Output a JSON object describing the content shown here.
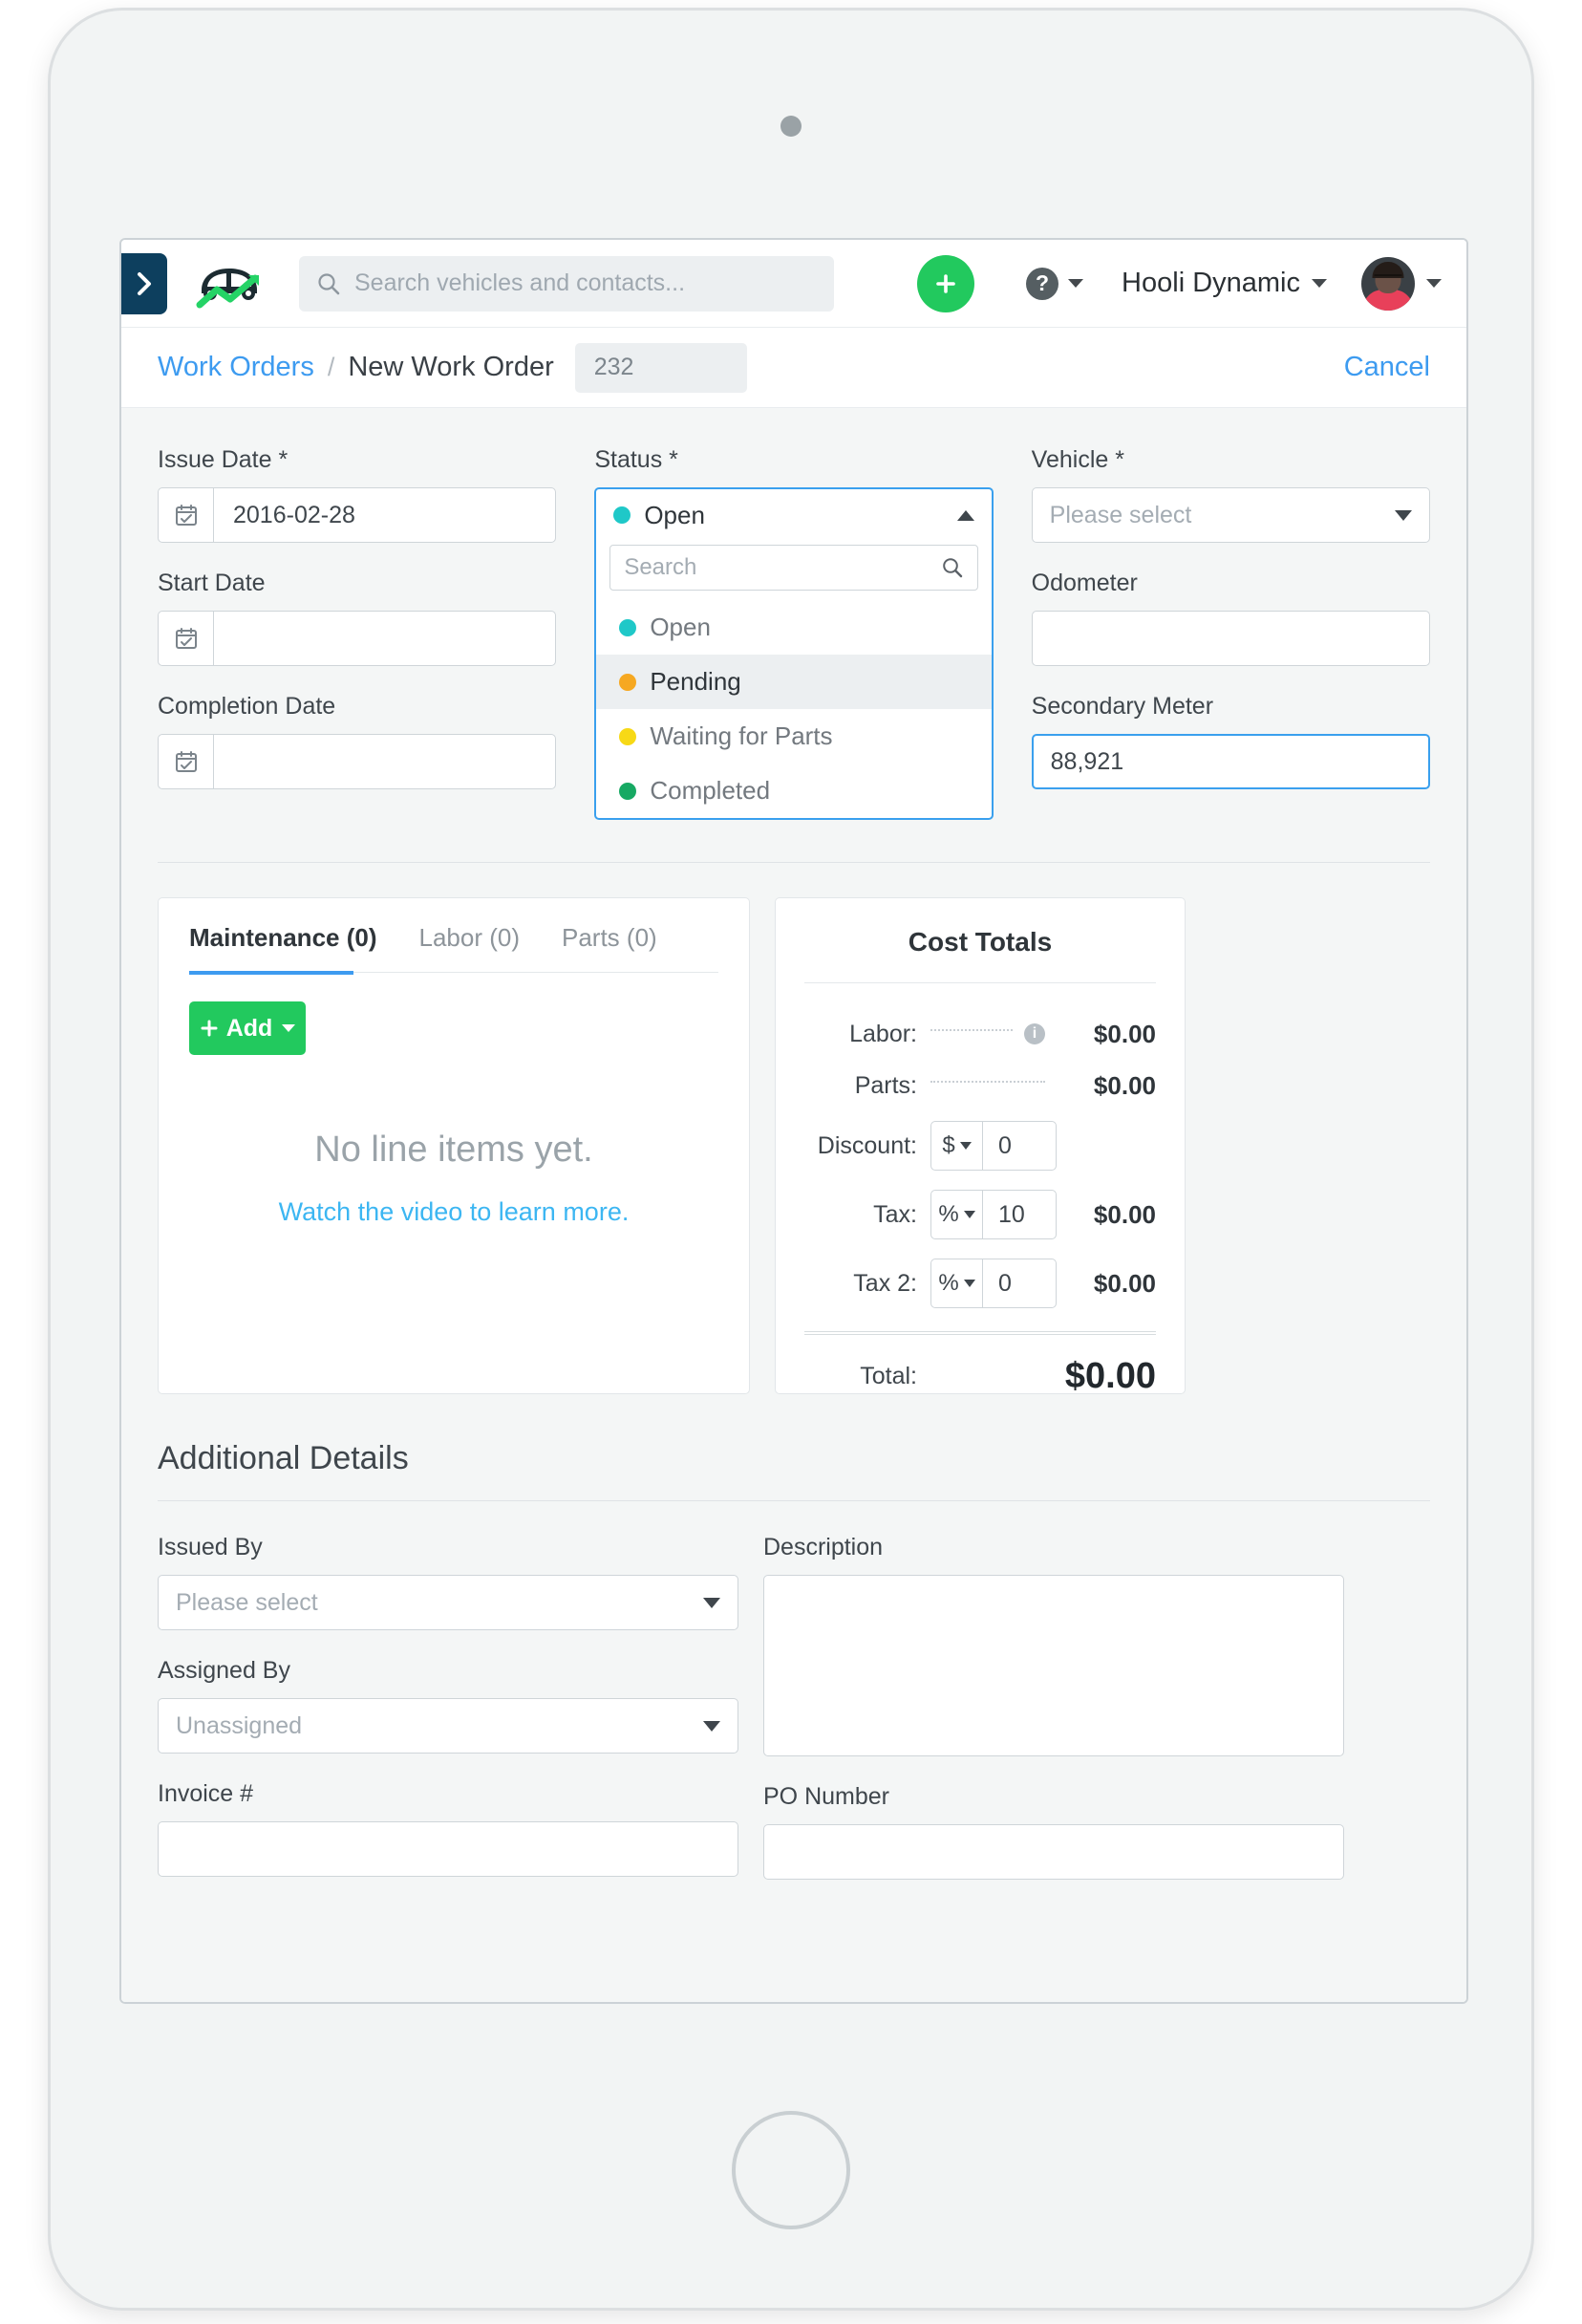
{
  "topnav": {
    "sidebar_toggle_icon": "chevron-right-icon",
    "logo_icon": "fleetio-car-logo",
    "search": {
      "placeholder": "Search vehicles and contacts...",
      "value": "",
      "icon": "search-icon"
    },
    "add_button_label": "+",
    "help_icon_label": "?",
    "org_name": "Hooli Dynamic",
    "avatar_icon": "user-avatar"
  },
  "breadcrumb": {
    "parent": "Work Orders",
    "separator": "/",
    "current": "New Work Order",
    "work_order_number": "232",
    "cancel_label": "Cancel"
  },
  "form": {
    "issue_date": {
      "label": "Issue Date *",
      "value": "2016-02-28",
      "icon": "calendar-icon"
    },
    "start_date": {
      "label": "Start Date",
      "value": "",
      "icon": "calendar-icon"
    },
    "completion_date": {
      "label": "Completion Date",
      "value": "",
      "icon": "calendar-icon"
    },
    "status": {
      "label": "Status *",
      "selected": "Open",
      "selected_color": "#1fc8c8",
      "search_placeholder": "Search",
      "search_value": "",
      "options": [
        {
          "label": "Open",
          "color": "#1fc8c8",
          "highlighted": false
        },
        {
          "label": "Pending",
          "color": "#f6a821",
          "highlighted": true
        },
        {
          "label": "Waiting for Parts",
          "color": "#f7d916",
          "highlighted": false
        },
        {
          "label": "Completed",
          "color": "#17a963",
          "highlighted": false
        }
      ]
    },
    "vehicle": {
      "label": "Vehicle *",
      "placeholder": "Please select",
      "value": ""
    },
    "odometer": {
      "label": "Odometer",
      "value": ""
    },
    "secondary_meter": {
      "label": "Secondary Meter",
      "value": "88,921"
    }
  },
  "line_items": {
    "tabs": [
      {
        "label": "Maintenance (0)",
        "active": true
      },
      {
        "label": "Labor (0)",
        "active": false
      },
      {
        "label": "Parts (0)",
        "active": false
      }
    ],
    "add_button": "Add",
    "empty_title": "No line items yet.",
    "empty_link": "Watch the video to learn more."
  },
  "cost_totals": {
    "title": "Cost Totals",
    "rows": [
      {
        "label": "Labor:",
        "amount": "$0.00",
        "has_info": true
      },
      {
        "label": "Parts:",
        "amount": "$0.00",
        "has_info": false
      }
    ],
    "discount": {
      "label": "Discount:",
      "unit": "$",
      "value": "0",
      "amount": ""
    },
    "tax": {
      "label": "Tax:",
      "unit": "%",
      "value": "10",
      "amount": "$0.00"
    },
    "tax2": {
      "label": "Tax 2:",
      "unit": "%",
      "value": "0",
      "amount": "$0.00"
    },
    "total": {
      "label": "Total:",
      "amount": "$0.00"
    }
  },
  "additional_details": {
    "title": "Additional Details",
    "issued_by": {
      "label": "Issued By",
      "placeholder": "Please select"
    },
    "assigned_by": {
      "label": "Assigned By",
      "placeholder": "Unassigned"
    },
    "invoice": {
      "label": "Invoice #",
      "value": ""
    },
    "description": {
      "label": "Description",
      "value": ""
    },
    "po_number": {
      "label": "PO Number",
      "value": ""
    }
  },
  "colors": {
    "accent_blue": "#3d9bf0",
    "green": "#22c95e",
    "navy": "#0d3f5e"
  }
}
